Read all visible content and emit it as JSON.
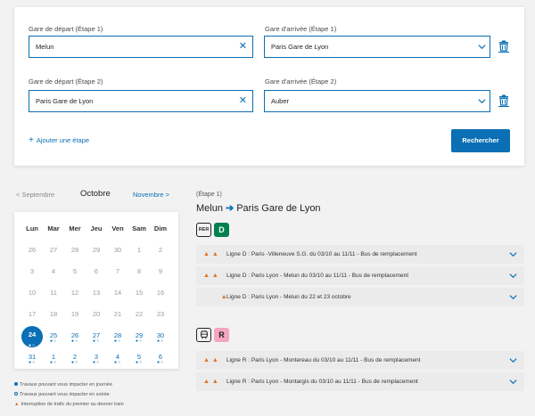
{
  "form": {
    "step1_dep_label": "Gare de départ (Étape 1)",
    "step1_dep_value": "Melun",
    "step1_arr_label": "Gare d'arrivée (Étape 1)",
    "step1_arr_value": "Paris Gare de Lyon",
    "step2_dep_label": "Gare de départ (Étape 2)",
    "step2_dep_value": "Paris Gare de Lyon",
    "step2_arr_label": "Gare d'arrivée (Étape 2)",
    "step2_arr_value": "Auber",
    "add_step": "Ajouter une étape",
    "search": "Rechercher",
    "clear_glyph": "✕"
  },
  "calendar": {
    "prev": "< Septembre",
    "current": "Octobre",
    "next": "Novembre >",
    "weekdays": [
      "Lun",
      "Mar",
      "Mer",
      "Jeu",
      "Ven",
      "Sam",
      "Dim"
    ],
    "rows": [
      [
        "26",
        "27",
        "28",
        "29",
        "30",
        "1",
        "2"
      ],
      [
        "3",
        "4",
        "5",
        "6",
        "7",
        "8",
        "9"
      ],
      [
        "10",
        "11",
        "12",
        "13",
        "14",
        "15",
        "16"
      ],
      [
        "17",
        "18",
        "19",
        "20",
        "21",
        "22",
        "23"
      ],
      [
        "24",
        "25",
        "26",
        "27",
        "28",
        "29",
        "30"
      ],
      [
        "31",
        "1",
        "2",
        "3",
        "4",
        "5",
        "6"
      ]
    ],
    "selected": "24",
    "legend": [
      "Travaux pouvant vous impacter en journée",
      "Travaux pouvant vous impacter en soirée",
      "Interruption de trafic du premier au dernier train"
    ],
    "colors": {
      "blue": "#0a6fb5",
      "orange": "#e07020"
    }
  },
  "results": {
    "step_label": "(Étape 1)",
    "from": "Melun",
    "to": "Paris Gare de Lyon",
    "arrow": "➔",
    "rer_logo": "RER",
    "line_d": "D",
    "line_d_color": "#00814f",
    "line_r": "R",
    "line_r_color": "#f4a6c0",
    "alerts_d": [
      "Ligne D : Paris -Villeneuve S.G. du 03/10 au 11/11 - Bus de remplacement",
      "Ligne D : Paris Lyon - Melun du 03/10 au 11/11 - Bus de remplacement",
      "Ligne D : Paris Lyon - Melun du 22 et 23 octobre"
    ],
    "alerts_r": [
      "Ligne R : Paris Lyon - Montereau du 03/10 au 11/11 - Bus de remplacement",
      "Ligne R : Paris Lyon - Montargis du 03/10 au 11/11 - Bus de remplacement"
    ]
  }
}
